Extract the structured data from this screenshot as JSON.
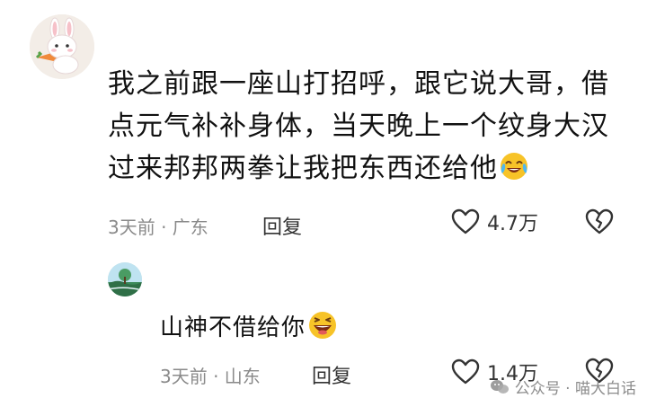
{
  "comment": {
    "lines": [
      "我之前跟一座山打招呼，跟它说大哥，借",
      "点元气补补身体，当天晚上一个纹身大汉",
      "过来邦邦两拳让我把东西还给他"
    ],
    "emoji": "crying-laughing-emoji",
    "meta": "3天前 · 广东",
    "reply_label": "回复",
    "like_count": "4.7万"
  },
  "reply": {
    "text": "山神不借给你",
    "emoji": "laughing-emoji",
    "meta": "3天前 · 山东",
    "reply_label": "回复",
    "like_count": "1.4万"
  },
  "watermark": {
    "text": "公众号 · 喵大白话"
  },
  "colors": {
    "meta_gray": "#8a8a8a",
    "text": "#111111",
    "emoji_yellow": "#f7c328"
  }
}
